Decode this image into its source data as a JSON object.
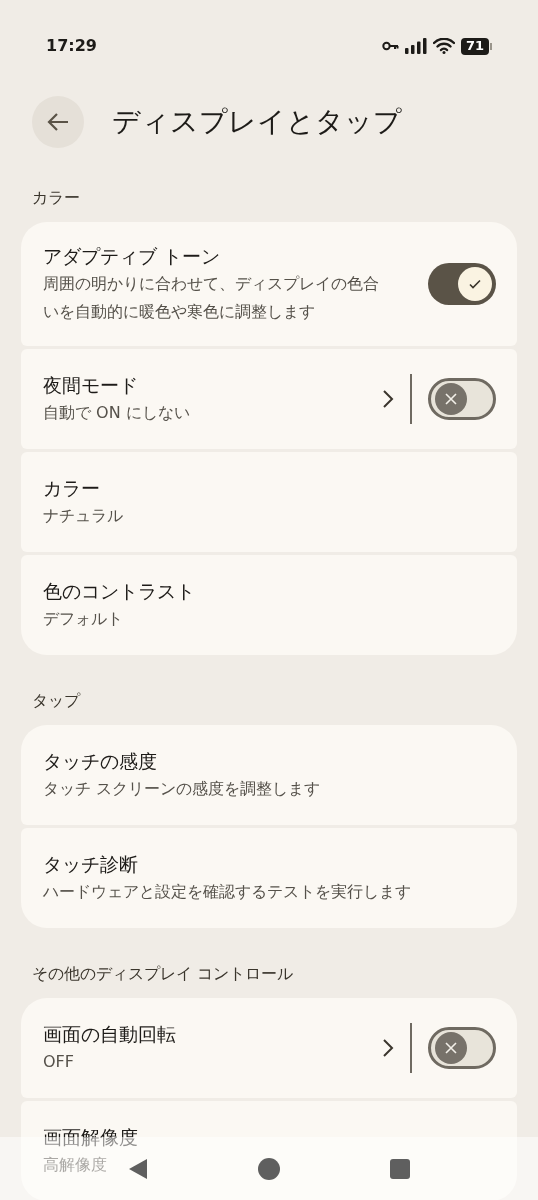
{
  "status_bar": {
    "time": "17:29",
    "battery": "71"
  },
  "header": {
    "title": "ディスプレイとタップ"
  },
  "sections": [
    {
      "title": "カラー",
      "items": [
        {
          "kind": "switch",
          "title": "アダプティブ トーン",
          "subtitle": "周囲の明かりに合わせて、ディスプレイの色合いを自動的に暖色や寒色に調整します",
          "on": true
        },
        {
          "kind": "link_switch",
          "title": "夜間モード",
          "subtitle": "自動で ON にしない",
          "on": false
        },
        {
          "kind": "link",
          "title": "カラー",
          "subtitle": "ナチュラル"
        },
        {
          "kind": "link",
          "title": "色のコントラスト",
          "subtitle": "デフォルト"
        }
      ]
    },
    {
      "title": "タップ",
      "items": [
        {
          "kind": "link",
          "title": "タッチの感度",
          "subtitle": "タッチ スクリーンの感度を調整します"
        },
        {
          "kind": "link",
          "title": "タッチ診断",
          "subtitle": "ハードウェアと設定を確認するテストを実行します"
        }
      ]
    },
    {
      "title": "その他のディスプレイ コントロール",
      "items": [
        {
          "kind": "link_switch",
          "title": "画面の自動回転",
          "subtitle": "OFF",
          "on": false
        },
        {
          "kind": "link",
          "title": "画面解像度",
          "subtitle": "高解像度"
        }
      ]
    }
  ]
}
